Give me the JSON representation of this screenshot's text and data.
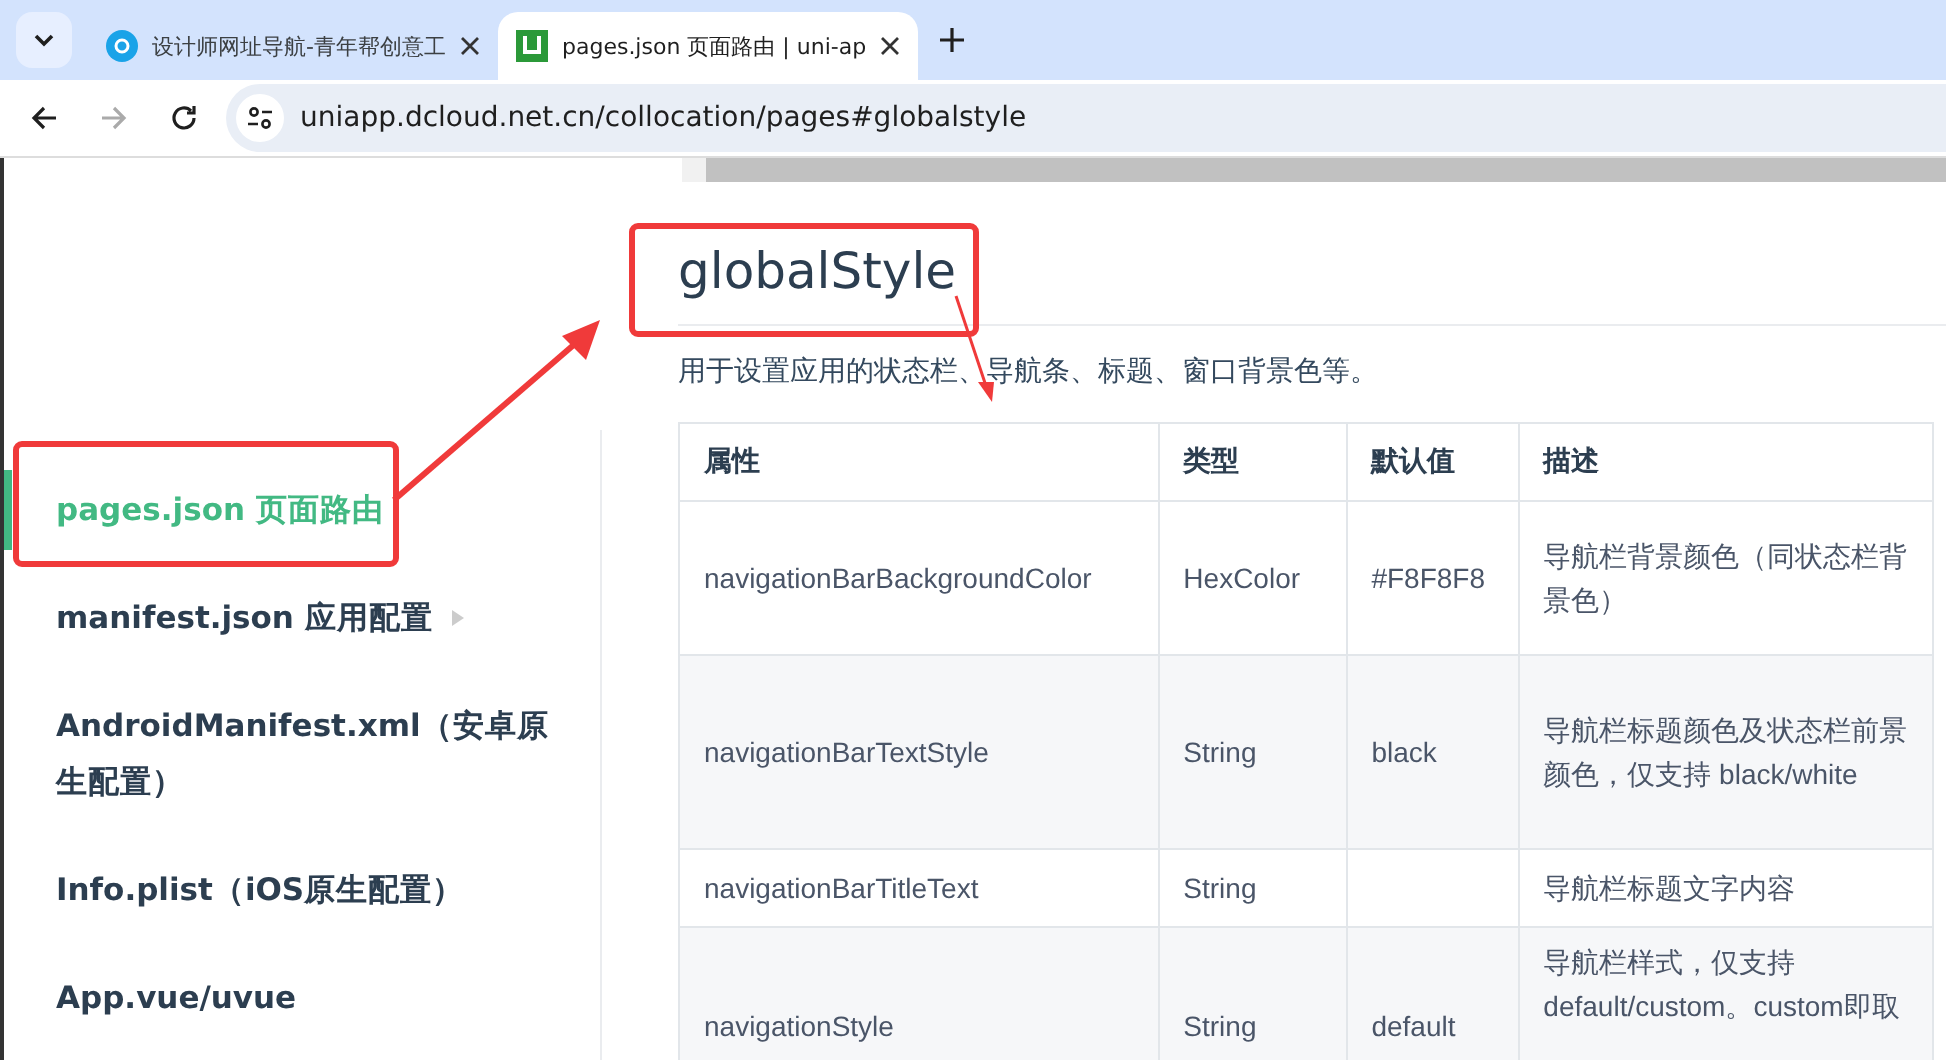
{
  "browser": {
    "tabs": [
      {
        "title": "设计师网址导航-青年帮创意工",
        "kind": "circle",
        "selected": false
      },
      {
        "title": "pages.json 页面路由 | uni-ap",
        "kind": "square",
        "selected": true
      }
    ],
    "url": "uniapp.dcloud.net.cn/collocation/pages#globalstyle"
  },
  "sidebar": {
    "items": [
      {
        "label": "pages.json 页面路由",
        "selected": true,
        "expandable": false
      },
      {
        "label": "manifest.json 应用配置",
        "selected": false,
        "expandable": true
      },
      {
        "label": "AndroidManifest.xml（安卓原生配置）",
        "selected": false,
        "expandable": false
      },
      {
        "label": "Info.plist（iOS原生配置）",
        "selected": false,
        "expandable": false
      },
      {
        "label": "App.vue/uvue",
        "selected": false,
        "expandable": false
      }
    ]
  },
  "content": {
    "heading": "globalStyle",
    "intro": "用于设置应用的状态栏、导航条、标题、窗口背景色等。",
    "table": {
      "columns": [
        "属性",
        "类型",
        "默认值",
        "描述"
      ],
      "rows": [
        [
          "navigationBarBackgroundColor",
          "HexColor",
          "#F8F8F8",
          "导航栏背景颜色（同状态栏背景色）"
        ],
        [
          "navigationBarTextStyle",
          "String",
          "black",
          "导航栏标题颜色及状态栏前景颜色，仅支持 black/white"
        ],
        [
          "navigationBarTitleText",
          "String",
          "",
          "导航栏标题文字内容"
        ],
        [
          "navigationStyle",
          "String",
          "default",
          "导航栏样式，仅支持 default/custom。custom即取"
        ]
      ]
    }
  }
}
